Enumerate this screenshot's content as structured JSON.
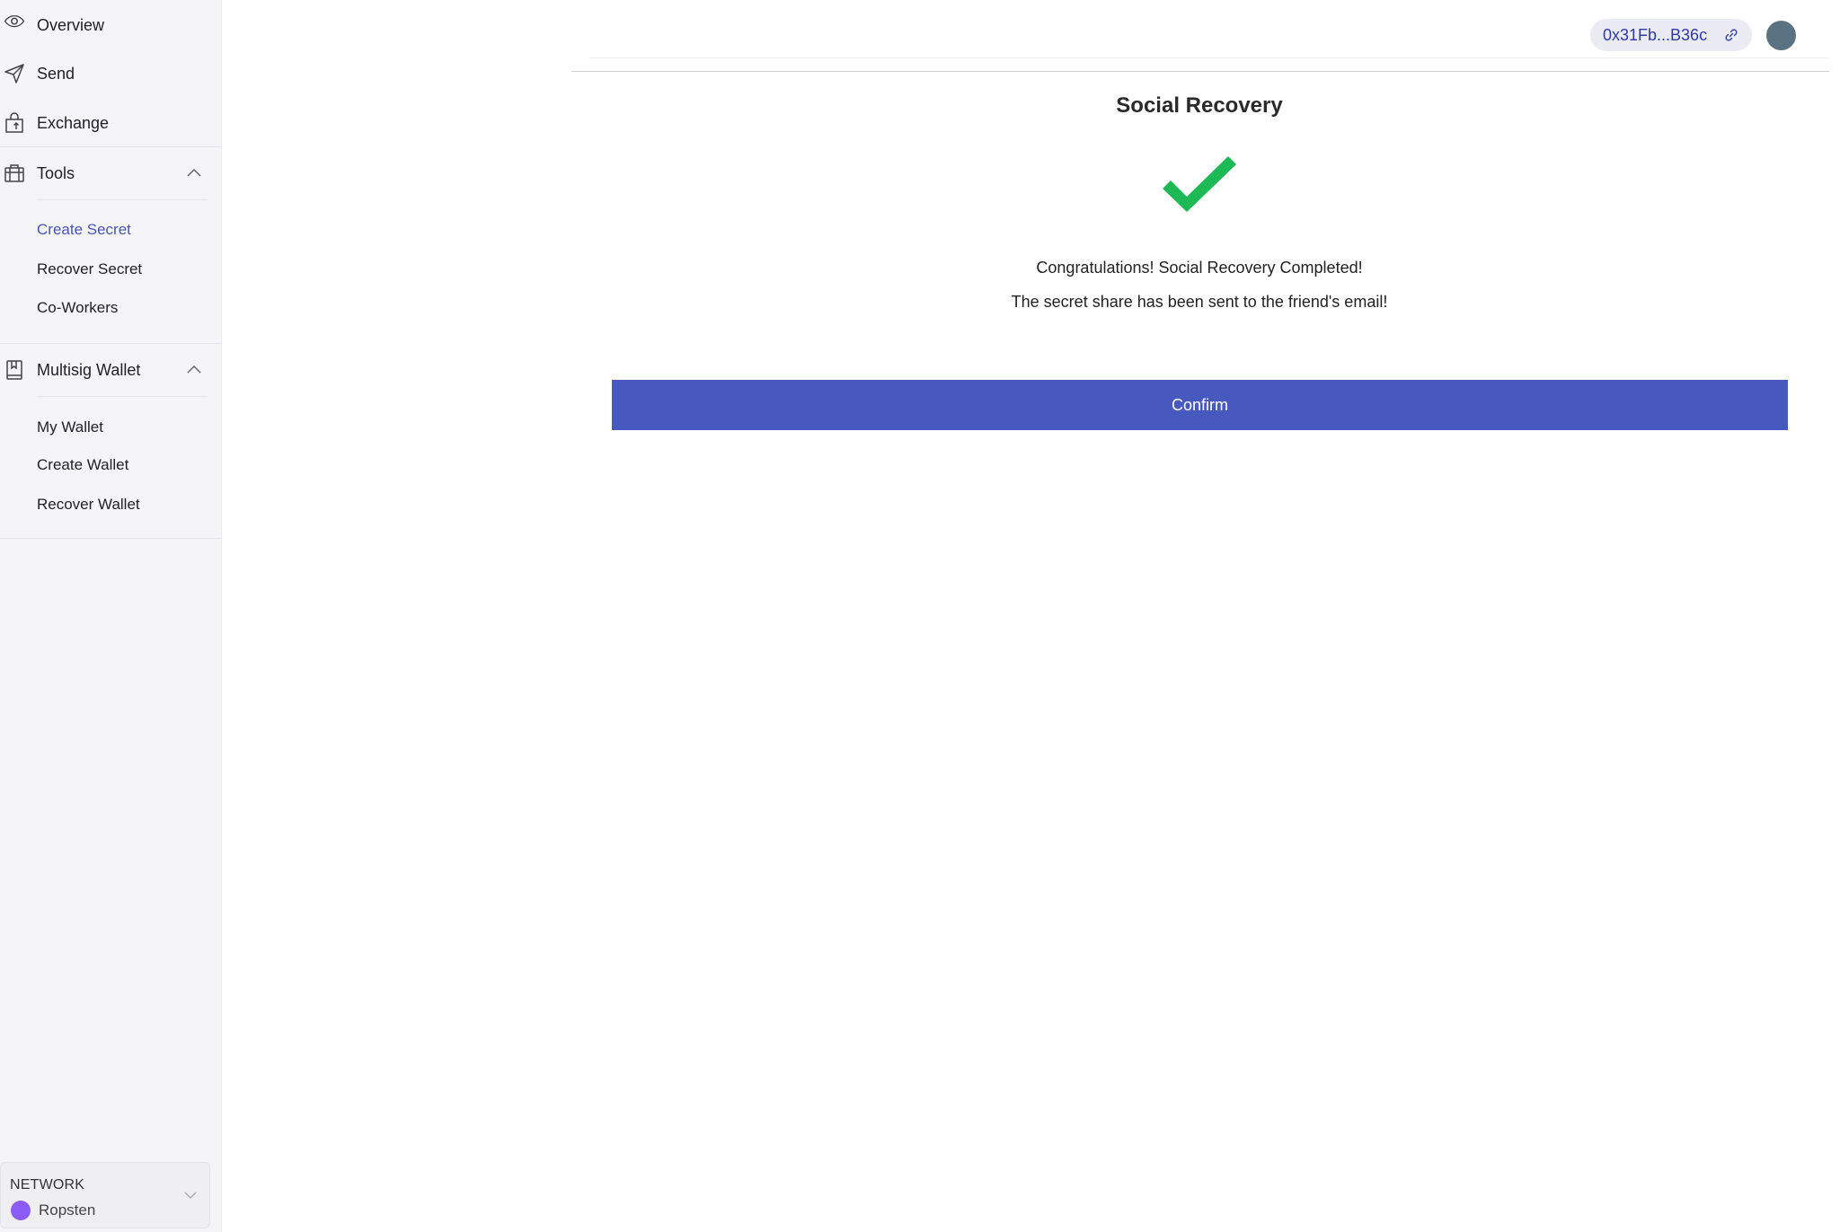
{
  "sidebar": {
    "overview": {
      "label": "Overview",
      "icon": "eye-icon"
    },
    "send": {
      "label": "Send",
      "icon": "send-icon"
    },
    "exchange": {
      "label": "Exchange",
      "icon": "exchange-icon"
    },
    "tools": {
      "label": "Tools",
      "icon": "toolbox-icon",
      "expanded": true,
      "items": [
        {
          "label": "Create Secret",
          "active": true
        },
        {
          "label": "Recover Secret",
          "active": false
        },
        {
          "label": "Co-Workers",
          "active": false
        }
      ]
    },
    "multisig": {
      "label": "Multisig Wallet",
      "icon": "wallet-book-icon",
      "expanded": true,
      "items": [
        {
          "label": "My Wallet"
        },
        {
          "label": "Create Wallet"
        },
        {
          "label": "Recover Wallet"
        }
      ]
    },
    "network": {
      "title": "NETWORK",
      "name": "Ropsten",
      "dot_color": "#8b5cf6"
    }
  },
  "header": {
    "address": "0x31Fb...B36c",
    "avatar_color": "#5b7282"
  },
  "main": {
    "title": "Social Recovery",
    "success_icon": "checkmark-icon",
    "success_color": "#1db954",
    "message_line1": "Congratulations! Social Recovery Completed!",
    "message_line2": "The secret share has been sent to the friend's email!",
    "confirm_label": "Confirm",
    "accent_color": "#4758be"
  }
}
